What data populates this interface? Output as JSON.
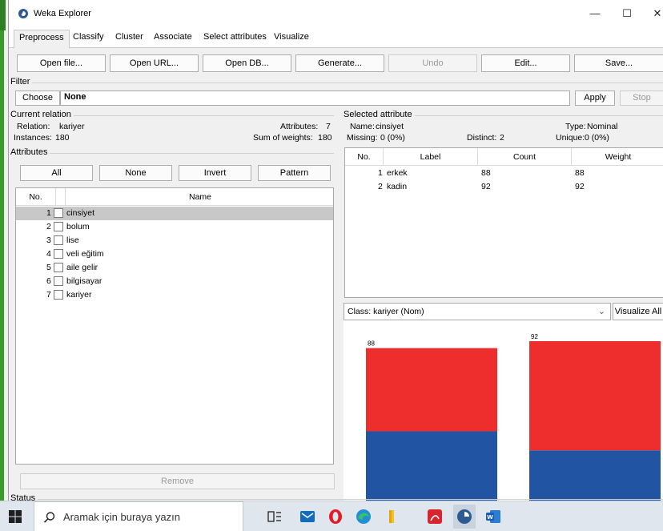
{
  "window": {
    "title": "Weka Explorer",
    "minimize": "—",
    "maximize": "☐",
    "close": "✕"
  },
  "tabs": [
    "Preprocess",
    "Classify",
    "Cluster",
    "Associate",
    "Select attributes",
    "Visualize"
  ],
  "toolbar": {
    "open_file": "Open file...",
    "open_url": "Open URL...",
    "open_db": "Open DB...",
    "generate": "Generate...",
    "undo": "Undo",
    "edit": "Edit...",
    "save": "Save..."
  },
  "filter": {
    "section": "Filter",
    "choose": "Choose",
    "value": "None",
    "apply": "Apply",
    "stop": "Stop"
  },
  "current_relation": {
    "section": "Current relation",
    "relation_label": "Relation:",
    "relation": "kariyer",
    "instances_label": "Instances:",
    "instances": "180",
    "attributes_label": "Attributes:",
    "attributes": "7",
    "sum_weights_label": "Sum of weights:",
    "sum_weights": "180"
  },
  "attributes": {
    "section": "Attributes",
    "buttons": {
      "all": "All",
      "none": "None",
      "invert": "Invert",
      "pattern": "Pattern"
    },
    "columns": {
      "no": "No.",
      "name": "Name"
    },
    "rows": [
      {
        "no": "1",
        "name": "cinsiyet"
      },
      {
        "no": "2",
        "name": "bolum"
      },
      {
        "no": "3",
        "name": "lise"
      },
      {
        "no": "4",
        "name": "veli eğitim"
      },
      {
        "no": "5",
        "name": "aile gelir"
      },
      {
        "no": "6",
        "name": "bilgisayar"
      },
      {
        "no": "7",
        "name": "kariyer"
      }
    ],
    "remove": "Remove"
  },
  "selected_attribute": {
    "section": "Selected attribute",
    "name_label": "Name:",
    "name": "cinsiyet",
    "type_label": "Type:",
    "type": "Nominal",
    "missing_label": "Missing:",
    "missing": "0 (0%)",
    "distinct_label": "Distinct:",
    "distinct": "2",
    "unique_label": "Unique:",
    "unique": "0 (0%)",
    "columns": {
      "no": "No.",
      "label": "Label",
      "count": "Count",
      "weight": "Weight"
    },
    "rows": [
      {
        "no": "1",
        "label": "erkek",
        "count": "88",
        "weight": "88"
      },
      {
        "no": "2",
        "label": "kadin",
        "count": "92",
        "weight": "92"
      }
    ]
  },
  "class_select": {
    "value": "Class: kariyer (Nom)",
    "visualize_all": "Visualize All"
  },
  "status": {
    "section": "Status"
  },
  "colors": {
    "class_a": "#ee2d2d",
    "class_b": "#2155a3"
  },
  "chart_data": {
    "type": "bar",
    "stacked": true,
    "categories": [
      "erkek",
      "kadin"
    ],
    "totals": [
      88,
      92
    ],
    "series": [
      {
        "values": [
          48,
          63
        ]
      },
      {
        "values": [
          40,
          29
        ]
      }
    ],
    "data_labels": [
      "88",
      "92"
    ],
    "ylim": [
      0,
      92
    ]
  },
  "taskbar": {
    "search_placeholder": "Aramak için buraya yazın"
  }
}
